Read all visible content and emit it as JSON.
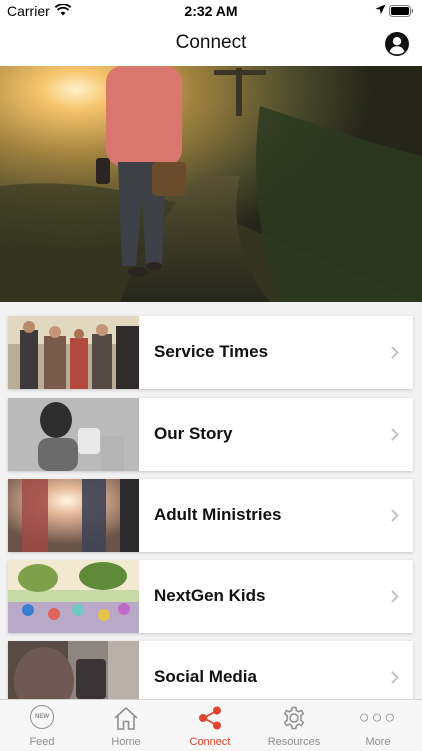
{
  "status_bar": {
    "carrier": "Carrier",
    "time": "2:32 AM"
  },
  "nav": {
    "title": "Connect"
  },
  "list": {
    "items": [
      {
        "label": "Service Times"
      },
      {
        "label": "Our Story"
      },
      {
        "label": "Adult Ministries"
      },
      {
        "label": "NextGen Kids"
      },
      {
        "label": "Social Media"
      }
    ]
  },
  "tabs": [
    {
      "label": "Feed",
      "icon": "new-badge-icon",
      "badge": "NEW"
    },
    {
      "label": "Home",
      "icon": "house-icon"
    },
    {
      "label": "Connect",
      "icon": "share-icon",
      "active": true
    },
    {
      "label": "Resources",
      "icon": "gear-icon"
    },
    {
      "label": "More",
      "icon": "ellipsis-icon",
      "glyph": "○○○"
    }
  ],
  "colors": {
    "accent": "#e0452b",
    "inactive": "#8e8e93"
  }
}
